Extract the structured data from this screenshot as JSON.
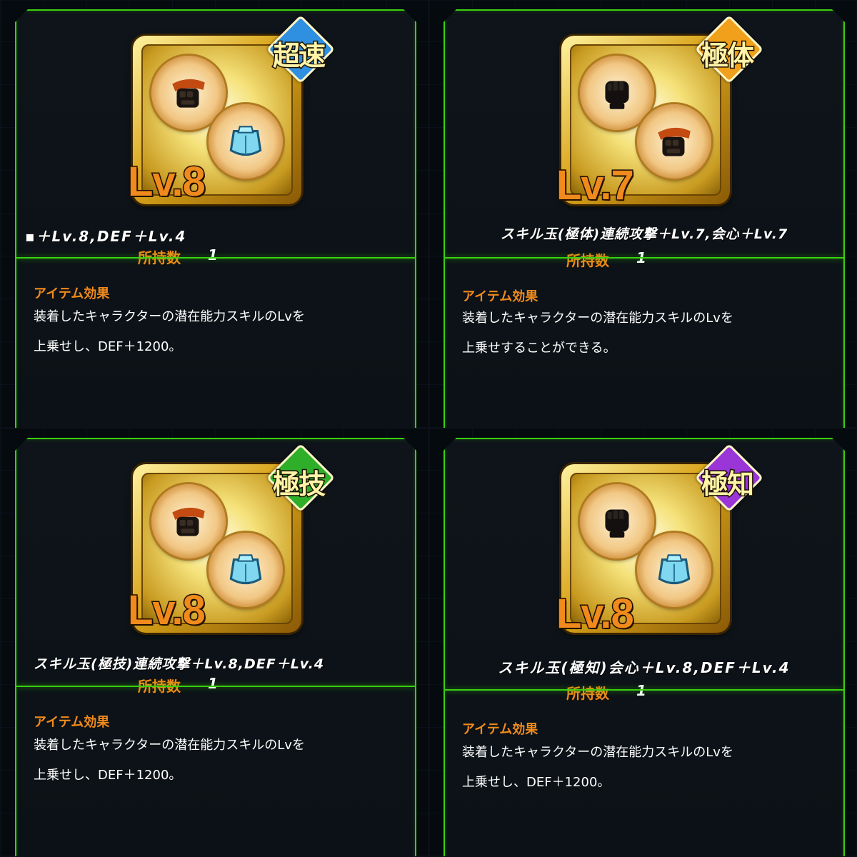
{
  "cards": [
    {
      "type_label": "超速",
      "type_color": "#2f8fe0",
      "level": "Lv.8",
      "orbs": [
        "fist-icon",
        "shield-orb-icon"
      ],
      "name": "▪＋Lv.8,DEF＋Lv.4",
      "owned_label": "所持数",
      "owned_count": "1",
      "effect_title": "アイテム効果",
      "effect_line1": "装着したキャラクターの潜在能力スキルのLvを",
      "effect_line2": "上乗せし、DEF＋1200。"
    },
    {
      "type_label": "極体",
      "type_color": "#f0a01a",
      "level": "Lv.7",
      "orbs": [
        "punch-icon",
        "fist-icon"
      ],
      "name": "スキル玉(極体)連続攻撃＋Lv.7,会心＋Lv.7",
      "owned_label": "所持数",
      "owned_count": "1",
      "effect_title": "アイテム効果",
      "effect_line1": "装着したキャラクターの潜在能力スキルのLvを",
      "effect_line2": "上乗せすることができる。"
    },
    {
      "type_label": "極技",
      "type_color": "#2fae2a",
      "level": "Lv.8",
      "orbs": [
        "fist-icon",
        "shield-orb-icon"
      ],
      "name": "スキル玉(極技)連続攻撃＋Lv.8,DEF＋Lv.4",
      "owned_label": "所持数",
      "owned_count": "1",
      "effect_title": "アイテム効果",
      "effect_line1": "装着したキャラクターの潜在能力スキルのLvを",
      "effect_line2": "上乗せし、DEF＋1200。"
    },
    {
      "type_label": "極知",
      "type_color": "#9a35d8",
      "level": "Lv.8",
      "orbs": [
        "punch-icon",
        "shield-orb-icon"
      ],
      "name": "スキル玉(極知)会心＋Lv.8,DEF＋Lv.4",
      "owned_label": "所持数",
      "owned_count": "1",
      "effect_title": "アイテム効果",
      "effect_line1": "装着したキャラクターの潜在能力スキルのLvを",
      "effect_line2": "上乗せし、DEF＋1200。"
    }
  ]
}
